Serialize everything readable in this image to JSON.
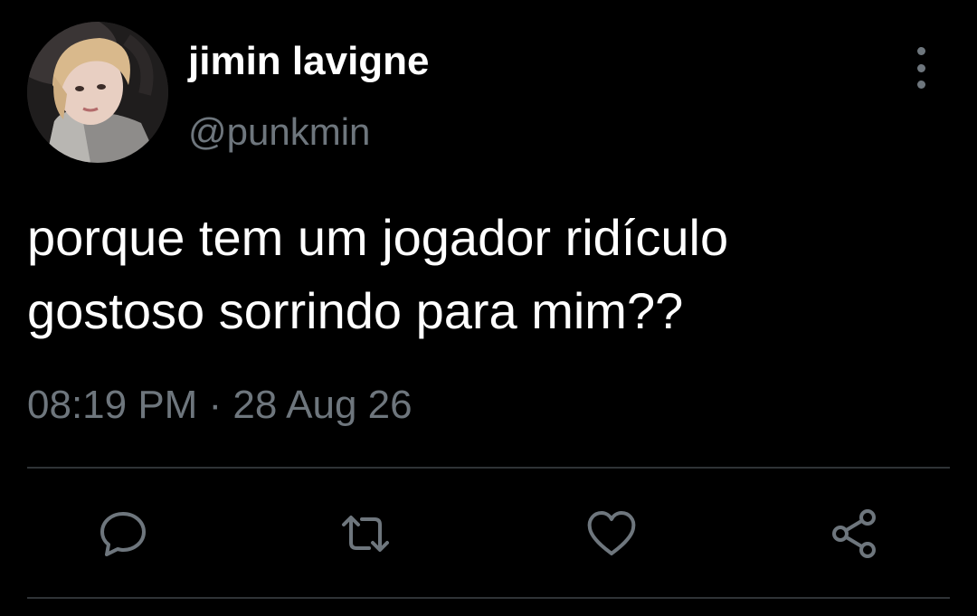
{
  "tweet": {
    "author": {
      "display_name": "jimin lavigne",
      "handle": "@punkmin",
      "avatar_icon": "profile-photo"
    },
    "text_lines": [
      "porque tem um jogador ridículo",
      "gostoso sorrindo para mim??"
    ],
    "timestamp": "08:19 PM · 28 Aug 26"
  },
  "actions": [
    {
      "name": "reply",
      "icon": "speech-bubble-icon"
    },
    {
      "name": "retweet",
      "icon": "retweet-arrows-icon"
    },
    {
      "name": "like",
      "icon": "heart-icon"
    },
    {
      "name": "share",
      "icon": "share-nodes-icon"
    }
  ],
  "colors": {
    "background": "#000000",
    "primary_text": "#ffffff",
    "secondary_text": "#6e767d",
    "divider": "#2f3336"
  }
}
